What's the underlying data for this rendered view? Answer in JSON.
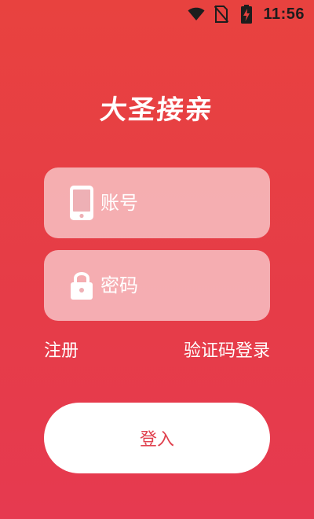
{
  "status_bar": {
    "time": "11:56",
    "icons": [
      "wifi-icon",
      "no-sim-icon",
      "battery-charging-icon"
    ]
  },
  "app": {
    "title": "大圣接亲"
  },
  "form": {
    "account_placeholder": "账号",
    "account_value": "",
    "account_icon": "phone-icon",
    "password_placeholder": "密码",
    "password_value": "",
    "password_icon": "lock-icon"
  },
  "links": {
    "register": "注册",
    "sms_login": "验证码登录"
  },
  "actions": {
    "login_label": "登入"
  },
  "colors": {
    "background": "#e8423f",
    "button_text": "#e0424f"
  }
}
